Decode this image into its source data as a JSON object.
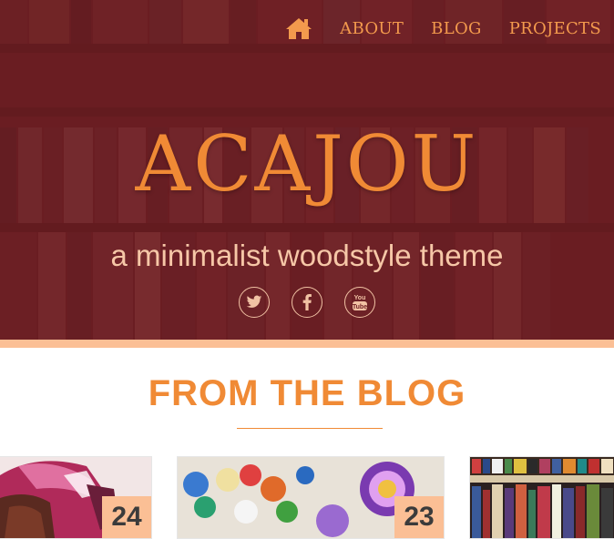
{
  "nav": {
    "home_icon": "home-icon",
    "items": [
      {
        "label": "ABOUT"
      },
      {
        "label": "BLOG"
      },
      {
        "label": "PROJECTS"
      }
    ]
  },
  "hero": {
    "title": "ACAJOU",
    "tagline": "a minimalist woodstyle theme",
    "social": [
      {
        "icon": "twitter-icon"
      },
      {
        "icon": "facebook-icon"
      },
      {
        "icon": "youtube-icon"
      }
    ]
  },
  "section": {
    "title": "FROM THE BLOG"
  },
  "posts": [
    {
      "day": "24",
      "image": "woman-headwrap-photo"
    },
    {
      "day": "23",
      "image": "paper-decorations-photo"
    },
    {
      "image": "bookshelf-photo"
    }
  ],
  "colors": {
    "accent": "#f08a35",
    "band": "#fbbf95",
    "hero_tint": "#701e23"
  }
}
